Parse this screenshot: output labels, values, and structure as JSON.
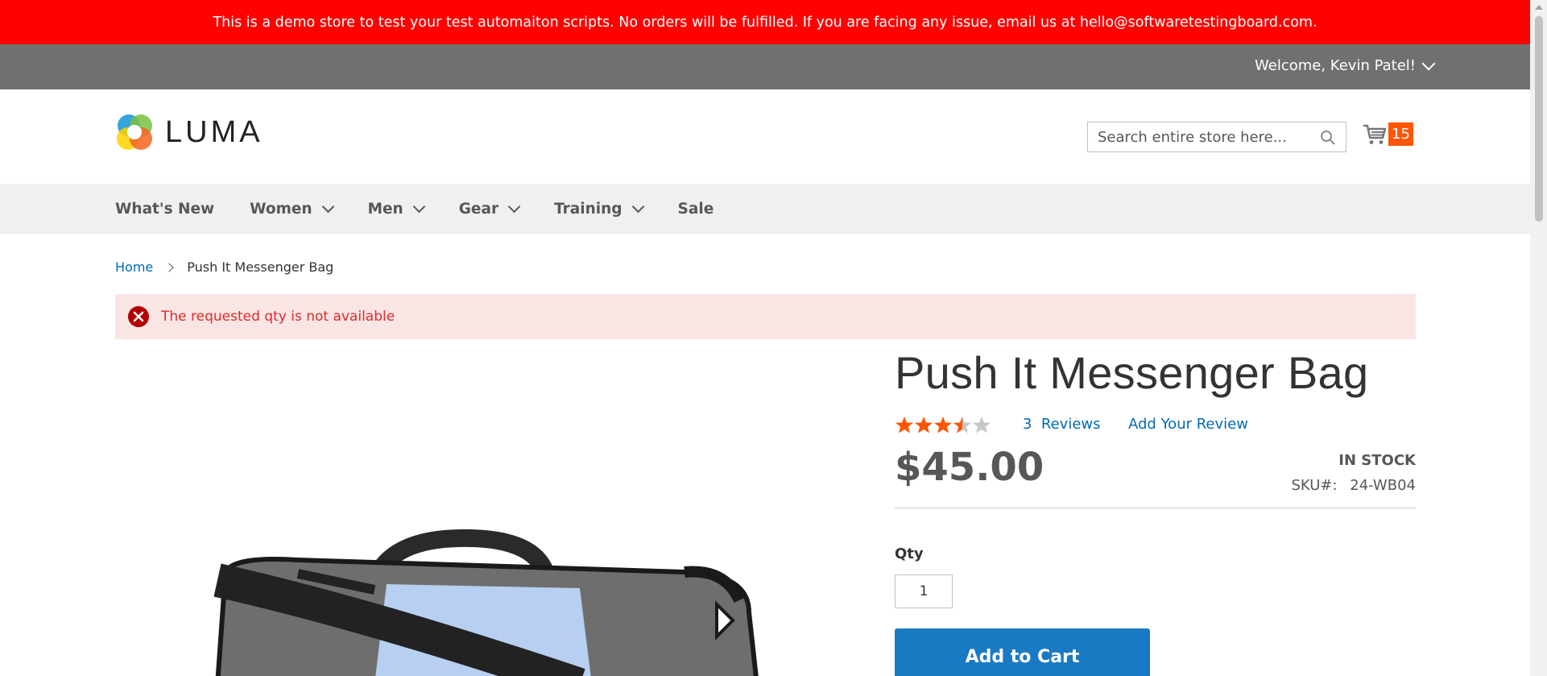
{
  "demo_banner": {
    "text": "This is a demo store to test your test automaiton scripts. No orders will be fulfilled. If you are facing any issue, email us at hello@softwaretestingboard.com."
  },
  "header_panel": {
    "welcome": "Welcome, Kevin Patel!"
  },
  "header": {
    "logo_text": "LUMA",
    "search_placeholder": "Search entire store here...",
    "cart_count": "15"
  },
  "nav": {
    "items": [
      {
        "label": "What's New",
        "has_dropdown": false
      },
      {
        "label": "Women",
        "has_dropdown": true
      },
      {
        "label": "Men",
        "has_dropdown": true
      },
      {
        "label": "Gear",
        "has_dropdown": true
      },
      {
        "label": "Training",
        "has_dropdown": true
      },
      {
        "label": "Sale",
        "has_dropdown": false
      }
    ]
  },
  "breadcrumb": {
    "home": "Home",
    "current": "Push It Messenger Bag"
  },
  "message": {
    "type": "error",
    "text": "The requested qty is not available"
  },
  "product": {
    "title": "Push It Messenger Bag",
    "rating_stars": 3.5,
    "rating_max": 5,
    "reviews_count": "3",
    "reviews_label": "Reviews",
    "add_review": "Add Your Review",
    "price": "$45.00",
    "stock": "In stock",
    "sku_label": "SKU#:",
    "sku": "24-WB04",
    "qty_label": "Qty",
    "qty_value": "1",
    "add_to_cart": "Add to Cart"
  },
  "colors": {
    "banner": "#ff0101",
    "panel": "#6e716e",
    "accent_blue": "#1979c3",
    "link_blue": "#006bb4",
    "star_orange": "#ff5501",
    "cart_badge": "#ff5501",
    "error_bg": "#fae5e5",
    "error_text": "#e02b27"
  }
}
